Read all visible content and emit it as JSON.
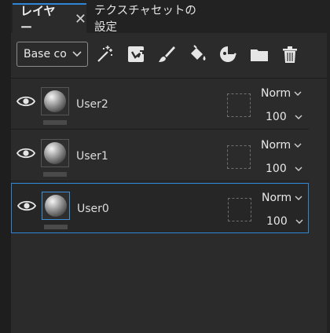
{
  "tabs": [
    {
      "label": "レイヤー",
      "close_icon": "✕"
    },
    {
      "label": "テクスチャセットの設定"
    }
  ],
  "toolbar": {
    "channel_select": "Base co",
    "tools": [
      "magic-wand-icon",
      "fill-layer-icon",
      "paint-brush-icon",
      "fill-bucket-icon",
      "smart-material-icon",
      "folder-icon",
      "trash-icon"
    ]
  },
  "layers": [
    {
      "name": "User2",
      "blend": "Norm",
      "opacity": "100",
      "selected": false
    },
    {
      "name": "User1",
      "blend": "Norm",
      "opacity": "100",
      "selected": false
    },
    {
      "name": "User0",
      "blend": "Norm",
      "opacity": "100",
      "selected": true
    }
  ],
  "colors": {
    "accent": "#2f86d6",
    "panel_bg": "#2b2b2b",
    "tab_bg": "#222222"
  }
}
